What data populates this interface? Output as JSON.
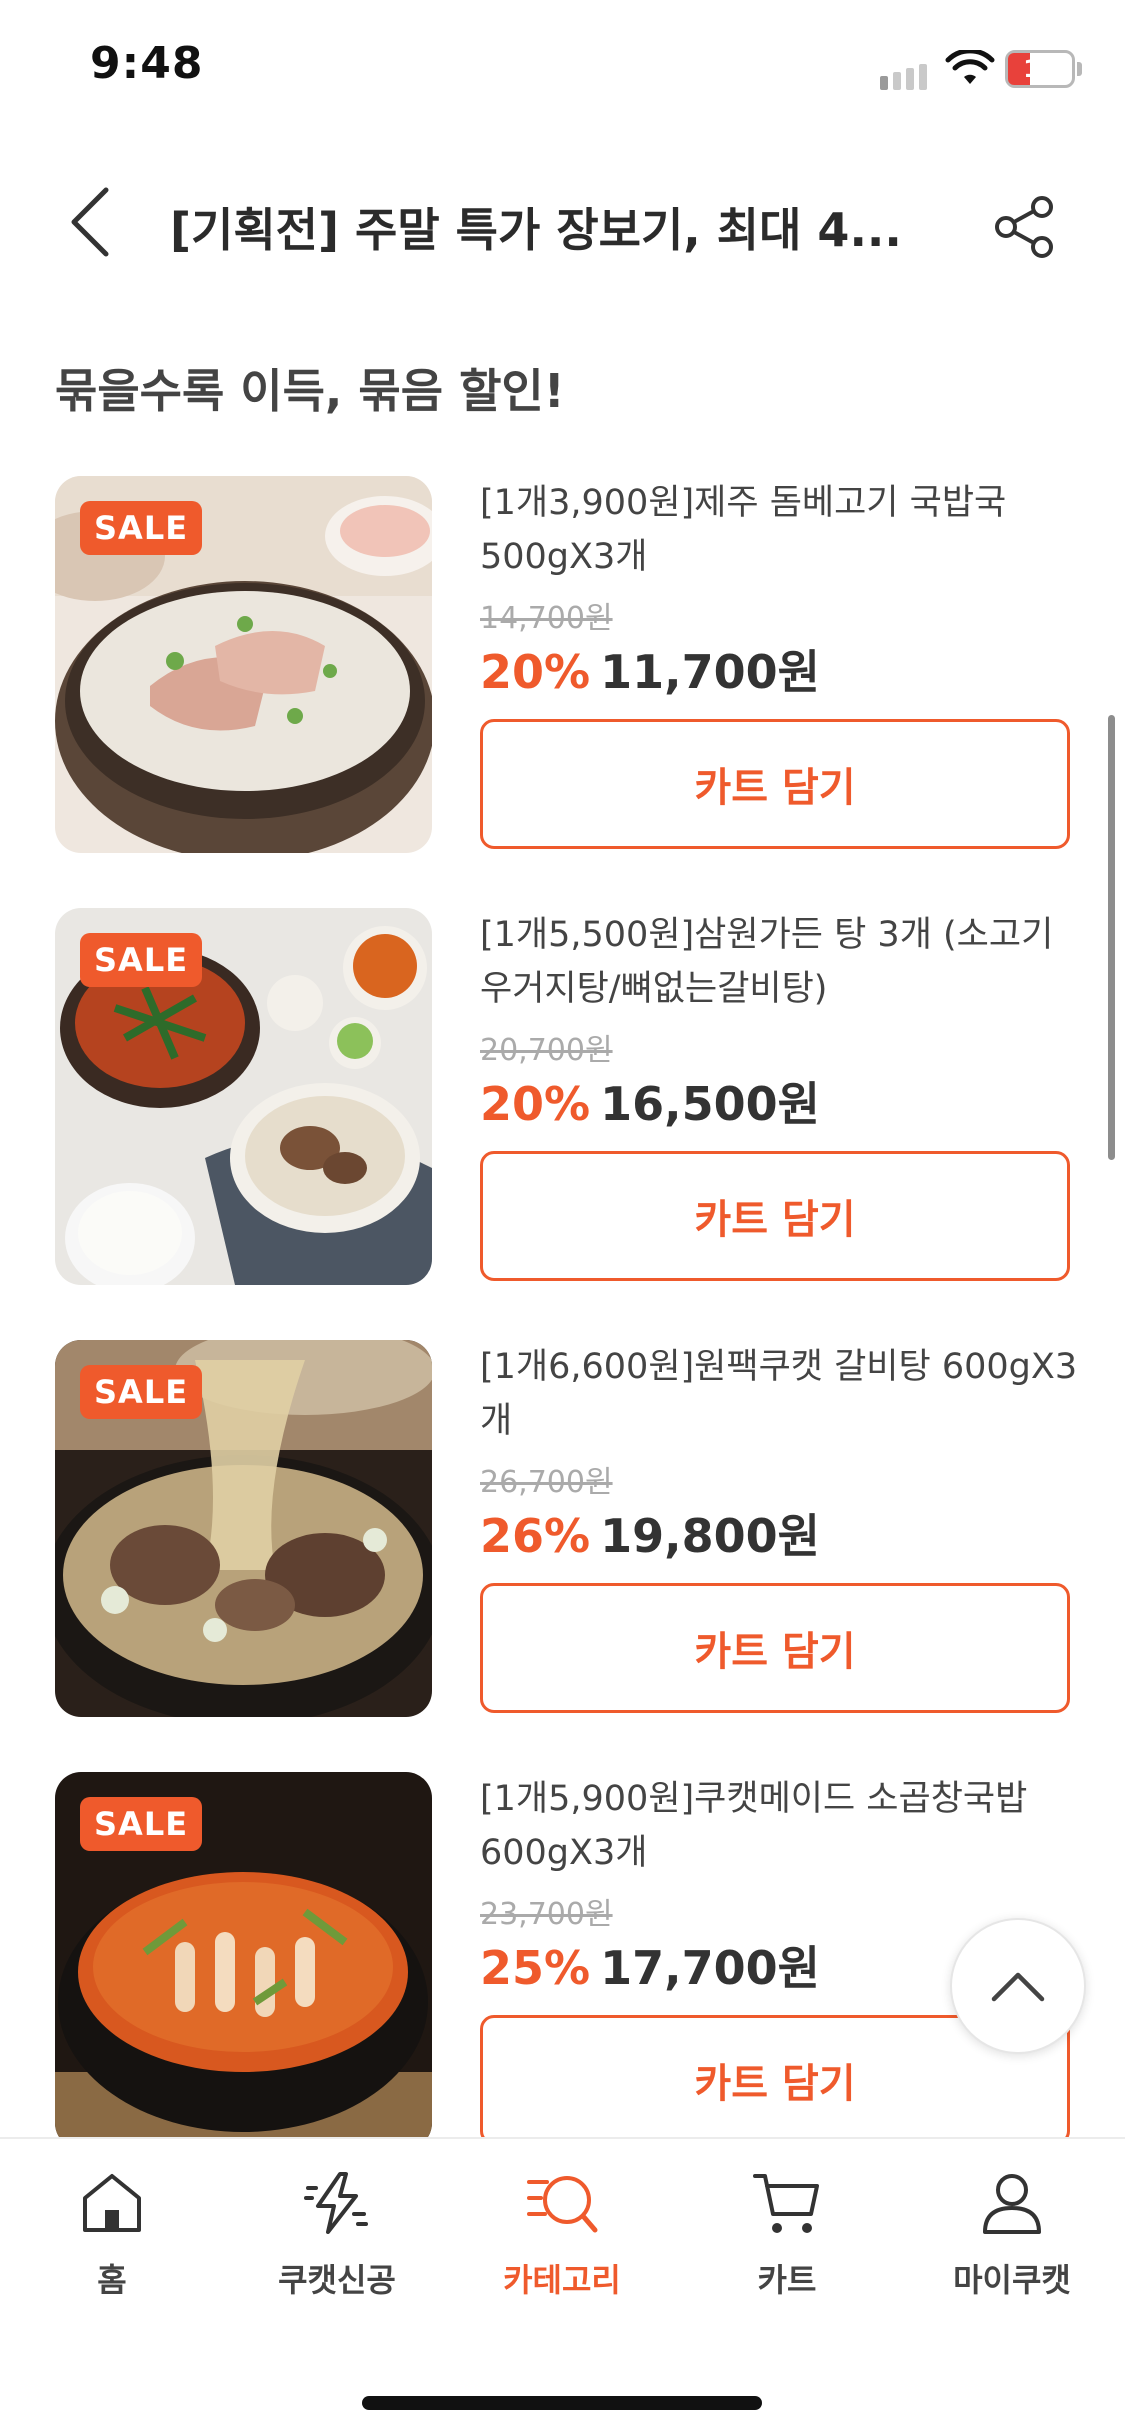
{
  "status_bar": {
    "time": "9:48",
    "battery": "11",
    "icons": [
      "signal-icon",
      "wifi-icon",
      "battery-icon"
    ]
  },
  "header": {
    "title": "[기획전] 주말 특가 장보기, 최대 4...",
    "back_icon": "chevron-left-icon",
    "share_icon": "share-icon"
  },
  "section": {
    "title": "묶을수록 이득, 묶음 할인!"
  },
  "products": [
    {
      "badge": "SALE",
      "name": "[1개3,900원]제주 돔베고기 국밥국 500gX3개",
      "original_price": "14,700원",
      "discount_rate": "20%",
      "price": "11,700원",
      "cart_label": "카트 담기"
    },
    {
      "badge": "SALE",
      "name": "[1개5,500원]삼원가든 탕 3개 (소고기우거지탕/뼈없는갈비탕)",
      "original_price": "20,700원",
      "discount_rate": "20%",
      "price": "16,500원",
      "cart_label": "카트 담기"
    },
    {
      "badge": "SALE",
      "name": "[1개6,600원]원팩쿠캣 갈비탕 600gX3개",
      "original_price": "26,700원",
      "discount_rate": "26%",
      "price": "19,800원",
      "cart_label": "카트 담기"
    },
    {
      "badge": "SALE",
      "name": "[1개5,900원]쿠캣메이드 소곱창국밥 600gX3개",
      "original_price": "23,700원",
      "discount_rate": "25%",
      "price": "17,700원",
      "cart_label": "카트 담기"
    }
  ],
  "scroll_top_icon": "chevron-up-icon",
  "bottom_nav": {
    "items": [
      {
        "label": "홈",
        "icon": "home-icon",
        "active": false
      },
      {
        "label": "쿠캣신공",
        "icon": "lightning-icon",
        "active": false
      },
      {
        "label": "카테고리",
        "icon": "category-search-icon",
        "active": true
      },
      {
        "label": "카트",
        "icon": "cart-icon",
        "active": false
      },
      {
        "label": "마이쿠캣",
        "icon": "person-icon",
        "active": false
      }
    ]
  },
  "colors": {
    "accent": "#ef5a2c",
    "text_dark": "#333333",
    "text_muted": "#aaaaaa"
  }
}
